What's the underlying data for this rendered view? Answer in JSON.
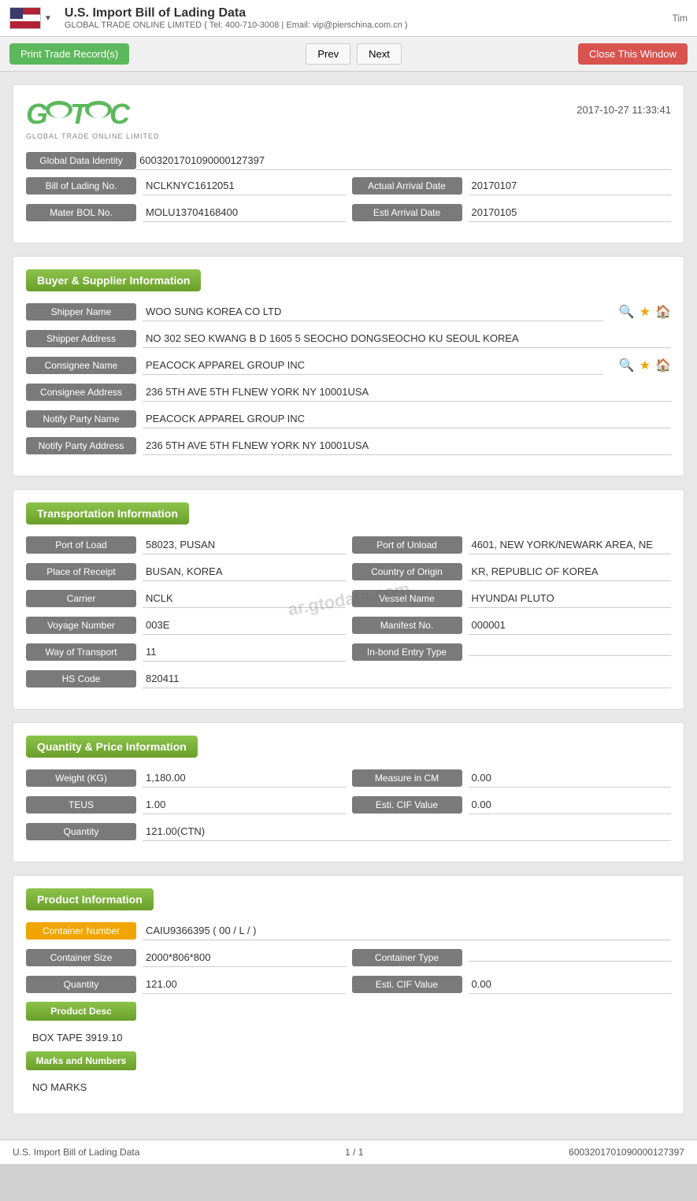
{
  "header": {
    "title": "U.S. Import Bill of Lading Data",
    "dropdown_arrow": "▼",
    "company": "GLOBAL TRADE ONLINE LIMITED ( Tel: 400-710-3008 | Email: vip@pierschina.com.cn )",
    "time": "Tim"
  },
  "toolbar": {
    "print_label": "Print Trade Record(s)",
    "prev_label": "Prev",
    "next_label": "Next",
    "close_label": "Close This Window"
  },
  "record": {
    "datetime": "2017-10-27 11:33:41",
    "logo_company": "GLOBAL TRADE ONLINE LIMITED",
    "global_data_identity_label": "Global Data Identity",
    "global_data_identity_value": "6003201701090000127397",
    "bill_of_lading_label": "Bill of Lading No.",
    "bill_of_lading_value": "NCLKNYC1612051",
    "actual_arrival_date_label": "Actual Arrival Date",
    "actual_arrival_date_value": "20170107",
    "mater_bol_label": "Mater BOL No.",
    "mater_bol_value": "MOLU13704168400",
    "esti_arrival_label": "Esti Arrival Date",
    "esti_arrival_value": "20170105"
  },
  "buyer_supplier": {
    "section_title": "Buyer & Supplier Information",
    "shipper_name_label": "Shipper Name",
    "shipper_name_value": "WOO SUNG KOREA CO LTD",
    "shipper_address_label": "Shipper Address",
    "shipper_address_value": "NO 302 SEO KWANG B D 1605 5 SEOCHO DONGSEOCHO KU SEOUL KOREA",
    "consignee_name_label": "Consignee Name",
    "consignee_name_value": "PEACOCK APPAREL GROUP INC",
    "consignee_address_label": "Consignee Address",
    "consignee_address_value": "236 5TH AVE 5TH FLNEW YORK NY 10001USA",
    "notify_party_name_label": "Notify Party Name",
    "notify_party_name_value": "PEACOCK APPAREL GROUP INC",
    "notify_party_address_label": "Notify Party Address",
    "notify_party_address_value": "236 5TH AVE 5TH FLNEW YORK NY 10001USA"
  },
  "transportation": {
    "section_title": "Transportation Information",
    "port_of_load_label": "Port of Load",
    "port_of_load_value": "58023, PUSAN",
    "port_of_unload_label": "Port of Unload",
    "port_of_unload_value": "4601, NEW YORK/NEWARK AREA, NE",
    "place_of_receipt_label": "Place of Receipt",
    "place_of_receipt_value": "BUSAN, KOREA",
    "country_of_origin_label": "Country of Origin",
    "country_of_origin_value": "KR, REPUBLIC OF KOREA",
    "carrier_label": "Carrier",
    "carrier_value": "NCLK",
    "vessel_name_label": "Vessel Name",
    "vessel_name_value": "HYUNDAI PLUTO",
    "voyage_number_label": "Voyage Number",
    "voyage_number_value": "003E",
    "manifest_no_label": "Manifest No.",
    "manifest_no_value": "000001",
    "way_of_transport_label": "Way of Transport",
    "way_of_transport_value": "11",
    "in_bond_entry_label": "In-bond Entry Type",
    "in_bond_entry_value": "",
    "hs_code_label": "HS Code",
    "hs_code_value": "820411",
    "watermark": "ar.gtodata.com"
  },
  "quantity_price": {
    "section_title": "Quantity & Price Information",
    "weight_kg_label": "Weight (KG)",
    "weight_kg_value": "1,180.00",
    "measure_in_cm_label": "Measure in CM",
    "measure_in_cm_value": "0.00",
    "teus_label": "TEUS",
    "teus_value": "1.00",
    "esti_cif_label": "Esti. CIF Value",
    "esti_cif_value": "0.00",
    "quantity_label": "Quantity",
    "quantity_value": "121.00(CTN)"
  },
  "product_info": {
    "section_title": "Product Information",
    "container_number_label": "Container Number",
    "container_number_value": "CAIU9366395 ( 00 / L / )",
    "container_size_label": "Container Size",
    "container_size_value": "2000*806*800",
    "container_type_label": "Container Type",
    "container_type_value": "",
    "quantity_label": "Quantity",
    "quantity_value": "121.00",
    "esti_cif_label": "Esti. CIF Value",
    "esti_cif_value": "0.00",
    "product_desc_label": "Product Desc",
    "product_desc_value": "BOX TAPE 3919.10",
    "marks_numbers_label": "Marks and Numbers",
    "marks_numbers_value": "NO MARKS"
  },
  "footer": {
    "left": "U.S. Import Bill of Lading Data",
    "center": "1 / 1",
    "right": "6003201701090000127397"
  }
}
